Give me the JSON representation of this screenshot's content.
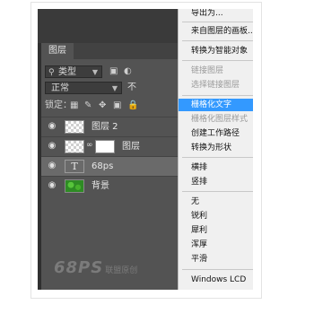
{
  "layers_panel": {
    "tab": "图层",
    "filter": {
      "label": "类型"
    },
    "blend_mode": {
      "value": "正常",
      "opacity_partial": "不"
    },
    "lock_label": "锁定：",
    "layers": [
      {
        "name": "图层 2",
        "visible": true,
        "thumb": "transparent"
      },
      {
        "name": "图层",
        "visible": true,
        "thumb": "transparent-with-mask"
      },
      {
        "name": "68ps",
        "visible": true,
        "thumb": "text",
        "selected": true
      },
      {
        "name": "背景",
        "visible": true,
        "thumb": "green"
      }
    ],
    "watermark": {
      "logo": "68PS",
      "text": "联盟原创"
    }
  },
  "context_menu": {
    "items": [
      {
        "label": "导出为...",
        "disabled": false,
        "highlighted": false
      },
      {
        "label": "来自图层的画板...",
        "disabled": false,
        "highlighted": false
      },
      {
        "label": "转换为智能对象",
        "disabled": false,
        "highlighted": false
      },
      {
        "label": "链接图层",
        "disabled": true,
        "highlighted": false
      },
      {
        "label": "选择链接图层",
        "disabled": true,
        "highlighted": false
      },
      {
        "label": "栅格化文字",
        "disabled": false,
        "highlighted": true
      },
      {
        "label": "栅格化图层样式",
        "disabled": true,
        "highlighted": false
      },
      {
        "label": "创建工作路径",
        "disabled": false,
        "highlighted": false
      },
      {
        "label": "转换为形状",
        "disabled": false,
        "highlighted": false
      },
      {
        "label": "横排",
        "disabled": false,
        "highlighted": false
      },
      {
        "label": "竖排",
        "disabled": false,
        "highlighted": false
      },
      {
        "label": "无",
        "disabled": false,
        "highlighted": false
      },
      {
        "label": "锐利",
        "disabled": false,
        "highlighted": false
      },
      {
        "label": "犀利",
        "disabled": false,
        "highlighted": false
      },
      {
        "label": "浑厚",
        "disabled": false,
        "highlighted": false
      },
      {
        "label": "平滑",
        "disabled": false,
        "highlighted": false
      },
      {
        "label": "Windows LCD",
        "disabled": false,
        "highlighted": false
      }
    ],
    "highlight_color": "#3399ff"
  },
  "icons": {
    "visibility": "eye-icon",
    "text_layer": "T",
    "link": "chain-link-icon"
  }
}
